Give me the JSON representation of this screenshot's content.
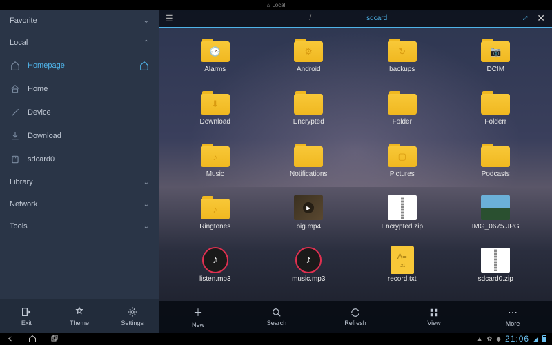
{
  "system": {
    "top_location": "Local",
    "clock": "21:06"
  },
  "sidebar": {
    "sections": {
      "favorite": "Favorite",
      "local": "Local",
      "library": "Library",
      "network": "Network",
      "tools": "Tools"
    },
    "local_items": [
      {
        "label": "Homepage",
        "icon": "home-outline",
        "active": true
      },
      {
        "label": "Home",
        "icon": "home"
      },
      {
        "label": "Device",
        "icon": "device"
      },
      {
        "label": "Download",
        "icon": "download"
      },
      {
        "label": "sdcard0",
        "icon": "sdcard"
      }
    ],
    "bottom": {
      "exit": "Exit",
      "theme": "Theme",
      "settings": "Settings"
    }
  },
  "header": {
    "crumbs": [
      "/",
      "sdcard"
    ]
  },
  "grid": [
    {
      "label": "Alarms",
      "type": "folder",
      "glyph": "🕑"
    },
    {
      "label": "Android",
      "type": "folder",
      "glyph": "⚙"
    },
    {
      "label": "backups",
      "type": "folder",
      "glyph": "↻"
    },
    {
      "label": "DCIM",
      "type": "folder",
      "glyph": "📷"
    },
    {
      "label": "Download",
      "type": "folder",
      "glyph": "⬇"
    },
    {
      "label": "Encrypted",
      "type": "folder",
      "glyph": ""
    },
    {
      "label": "Folder",
      "type": "folder",
      "glyph": ""
    },
    {
      "label": "Folderr",
      "type": "folder",
      "glyph": ""
    },
    {
      "label": "Music",
      "type": "folder",
      "glyph": "♪"
    },
    {
      "label": "Notifications",
      "type": "folder",
      "glyph": ""
    },
    {
      "label": "Pictures",
      "type": "folder",
      "glyph": "▢"
    },
    {
      "label": "Podcasts",
      "type": "folder",
      "glyph": ""
    },
    {
      "label": "Ringtones",
      "type": "folder",
      "glyph": "♪"
    },
    {
      "label": "big.mp4",
      "type": "video"
    },
    {
      "label": "Encrypted.zip",
      "type": "zip"
    },
    {
      "label": "IMG_0675.JPG",
      "type": "photo"
    },
    {
      "label": "listen.mp3",
      "type": "audio"
    },
    {
      "label": "music.mp3",
      "type": "audio"
    },
    {
      "label": "record.txt",
      "type": "txt"
    },
    {
      "label": "sdcard0.zip",
      "type": "zip"
    }
  ],
  "toolbar": {
    "new": "New",
    "search": "Search",
    "refresh": "Refresh",
    "view": "View",
    "more": "More"
  }
}
